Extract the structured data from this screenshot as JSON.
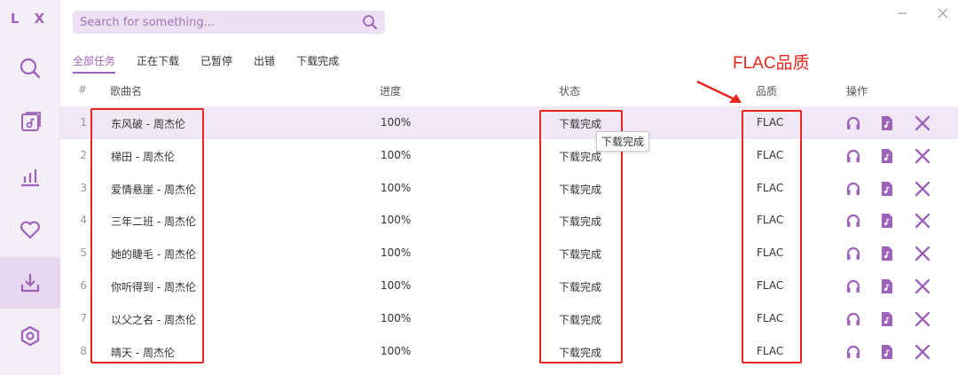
{
  "app": {
    "logo": "L X"
  },
  "search": {
    "placeholder": "Search for something..."
  },
  "tabs": [
    {
      "label": "全部任务",
      "active": true
    },
    {
      "label": "正在下载",
      "active": false
    },
    {
      "label": "已暂停",
      "active": false
    },
    {
      "label": "出错",
      "active": false
    },
    {
      "label": "下载完成",
      "active": false
    }
  ],
  "annotation": {
    "label": "FLAC品质"
  },
  "table": {
    "headers": {
      "num": "#",
      "name": "歌曲名",
      "progress": "进度",
      "status": "状态",
      "quality": "品质",
      "actions": "操作"
    },
    "rows": [
      {
        "num": "1",
        "name": "东风破 - 周杰伦",
        "progress": "100%",
        "status": "下载完成",
        "quality": "FLAC"
      },
      {
        "num": "2",
        "name": "梯田 - 周杰伦",
        "progress": "100%",
        "status": "下载完成",
        "quality": "FLAC"
      },
      {
        "num": "3",
        "name": "爱情悬崖 - 周杰伦",
        "progress": "100%",
        "status": "下载完成",
        "quality": "FLAC"
      },
      {
        "num": "4",
        "name": "三年二班 - 周杰伦",
        "progress": "100%",
        "status": "下载完成",
        "quality": "FLAC"
      },
      {
        "num": "5",
        "name": "她的睫毛 - 周杰伦",
        "progress": "100%",
        "status": "下载完成",
        "quality": "FLAC"
      },
      {
        "num": "6",
        "name": "你听得到 - 周杰伦",
        "progress": "100%",
        "status": "下载完成",
        "quality": "FLAC"
      },
      {
        "num": "7",
        "name": "以父之名 - 周杰伦",
        "progress": "100%",
        "status": "下载完成",
        "quality": "FLAC"
      },
      {
        "num": "8",
        "name": "晴天 - 周杰伦",
        "progress": "100%",
        "status": "下载完成",
        "quality": "FLAC"
      }
    ]
  },
  "tooltip": {
    "text": "下载完成"
  },
  "colors": {
    "accent": "#9e63b8",
    "annotation": "#e6261f",
    "sidebar_bg": "#f4eef7",
    "row_highlight": "#f1e8f5"
  },
  "icons": {
    "sidebar": [
      "search-icon",
      "playlist-icon",
      "chart-icon",
      "heart-icon",
      "download-icon",
      "settings-icon"
    ],
    "row_actions": [
      "headphones-icon",
      "music-file-icon",
      "delete-icon"
    ],
    "window": [
      "minimize-icon",
      "close-icon"
    ]
  }
}
